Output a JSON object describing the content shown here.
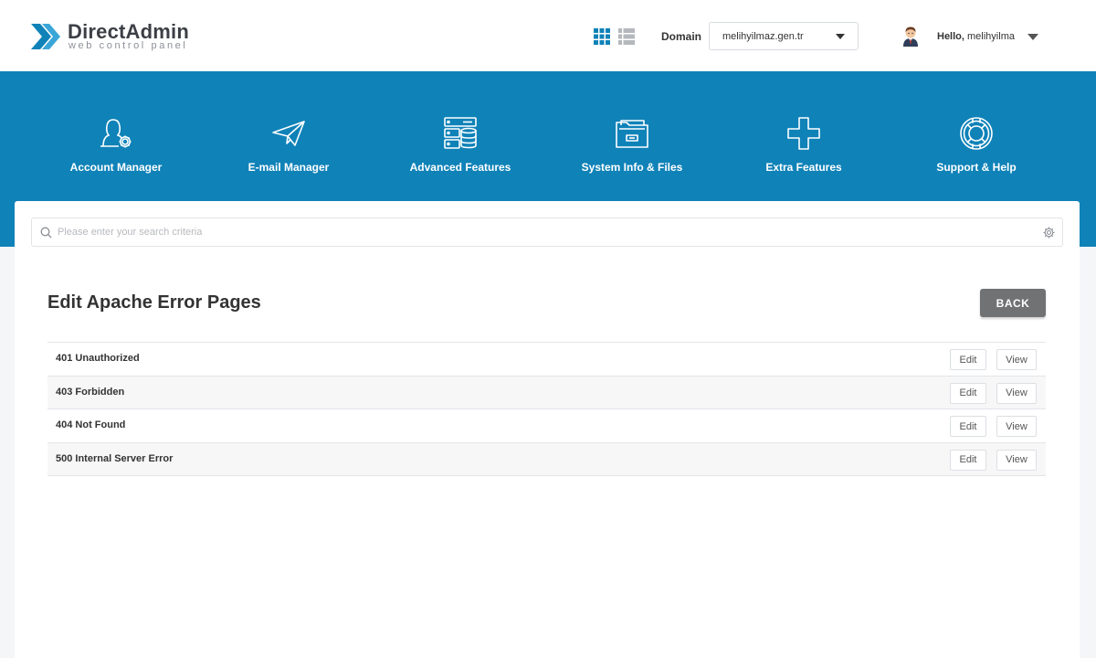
{
  "brand": {
    "title": "DirectAdmin",
    "subtitle": "web control panel",
    "accent": "#0f82b8"
  },
  "header": {
    "domain_label": "Domain",
    "domain_value": "melihyilmaz.gen.tr",
    "hello_prefix": "Hello,",
    "username": "melihyilma"
  },
  "nav": {
    "items": [
      {
        "label": "Account Manager",
        "icon": "user-gear-icon"
      },
      {
        "label": "E-mail Manager",
        "icon": "paper-plane-icon"
      },
      {
        "label": "Advanced Features",
        "icon": "server-database-icon"
      },
      {
        "label": "System Info & Files",
        "icon": "folder-icon"
      },
      {
        "label": "Extra Features",
        "icon": "plus-icon"
      },
      {
        "label": "Support & Help",
        "icon": "lifebuoy-icon"
      }
    ]
  },
  "search": {
    "placeholder": "Please enter your search criteria"
  },
  "page": {
    "title": "Edit Apache Error Pages",
    "back_label": "BACK"
  },
  "table": {
    "rows": [
      {
        "label": "401 Unauthorized",
        "edit": "Edit",
        "view": "View"
      },
      {
        "label": "403 Forbidden",
        "edit": "Edit",
        "view": "View"
      },
      {
        "label": "404 Not Found",
        "edit": "Edit",
        "view": "View"
      },
      {
        "label": "500 Internal Server Error",
        "edit": "Edit",
        "view": "View"
      }
    ]
  }
}
